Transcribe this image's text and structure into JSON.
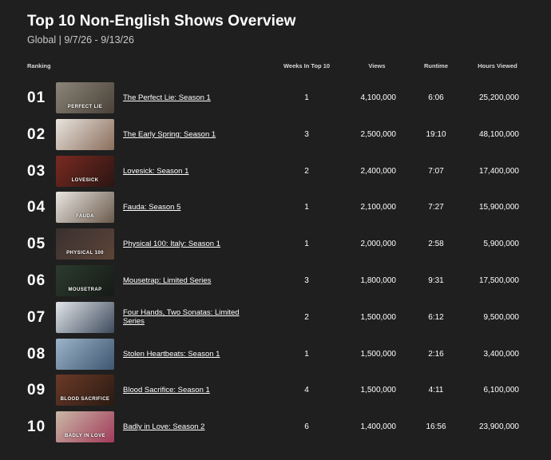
{
  "header": {
    "title": "Top 10 Non-English Shows Overview",
    "subtitle": "Global | 9/7/26 - 9/13/26"
  },
  "columns": {
    "ranking": "Ranking",
    "weeks": "Weeks In Top 10",
    "views": "Views",
    "runtime": "Runtime",
    "hours": "Hours Viewed"
  },
  "rows": [
    {
      "rank": "01",
      "title": "The Perfect Lie: Season 1",
      "weeks": "1",
      "views": "4,100,000",
      "runtime": "6:06",
      "hours": "25,200,000",
      "thumb_caption": "PERFECT LIE",
      "thumb_colors": [
        "#8b8478",
        "#4a4238"
      ]
    },
    {
      "rank": "02",
      "title": "The Early Spring: Season 1",
      "weeks": "3",
      "views": "2,500,000",
      "runtime": "19:10",
      "hours": "48,100,000",
      "thumb_caption": "",
      "thumb_colors": [
        "#e8e4df",
        "#8a6d5a"
      ]
    },
    {
      "rank": "03",
      "title": "Lovesick: Season 1",
      "weeks": "2",
      "views": "2,400,000",
      "runtime": "7:07",
      "hours": "17,400,000",
      "thumb_caption": "LOVESICK",
      "thumb_colors": [
        "#7a2a22",
        "#2a1512"
      ]
    },
    {
      "rank": "04",
      "title": "Fauda: Season 5",
      "weeks": "1",
      "views": "2,100,000",
      "runtime": "7:27",
      "hours": "15,900,000",
      "thumb_caption": "FAUDA",
      "thumb_colors": [
        "#e9e6e1",
        "#6b5a4c"
      ]
    },
    {
      "rank": "05",
      "title": "Physical 100: Italy: Season 1",
      "weeks": "1",
      "views": "2,000,000",
      "runtime": "2:58",
      "hours": "5,900,000",
      "thumb_caption": "PHYSICAL 100",
      "thumb_colors": [
        "#3a3030",
        "#5c4538"
      ]
    },
    {
      "rank": "06",
      "title": "Mousetrap: Limited Series",
      "weeks": "3",
      "views": "1,800,000",
      "runtime": "9:31",
      "hours": "17,500,000",
      "thumb_caption": "MOUSETRAP",
      "thumb_colors": [
        "#2c3b2f",
        "#151a16"
      ]
    },
    {
      "rank": "07",
      "title": "Four Hands, Two Sonatas: Limited Series",
      "weeks": "2",
      "views": "1,500,000",
      "runtime": "6:12",
      "hours": "9,500,000",
      "thumb_caption": "",
      "thumb_colors": [
        "#e2e6ea",
        "#3d4a5c"
      ]
    },
    {
      "rank": "08",
      "title": "Stolen Heartbeats: Season 1",
      "weeks": "1",
      "views": "1,500,000",
      "runtime": "2:16",
      "hours": "3,400,000",
      "thumb_caption": "",
      "thumb_colors": [
        "#9bb4c8",
        "#3e5670"
      ]
    },
    {
      "rank": "09",
      "title": "Blood Sacrifice: Season 1",
      "weeks": "4",
      "views": "1,500,000",
      "runtime": "4:11",
      "hours": "6,100,000",
      "thumb_caption": "BLOOD SACRIFICE",
      "thumb_colors": [
        "#6b3a28",
        "#2a1a12"
      ]
    },
    {
      "rank": "10",
      "title": "Badly in Love: Season 2",
      "weeks": "6",
      "views": "1,400,000",
      "runtime": "16:56",
      "hours": "23,900,000",
      "thumb_caption": "BADLY IN LOVE",
      "thumb_colors": [
        "#c9b8a6",
        "#a33a5a"
      ]
    }
  ]
}
